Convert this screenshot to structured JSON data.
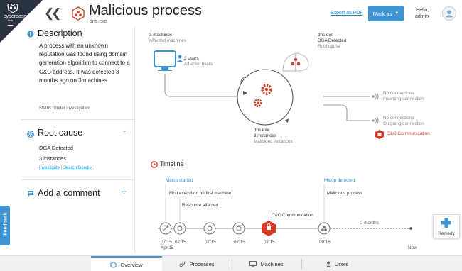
{
  "brand": {
    "name": "cybereason"
  },
  "header": {
    "title": "Malicious process",
    "subtitle": "dns.exe",
    "export_label": "Export as PDF",
    "mark_as_label": "Mark as",
    "greeting": "Hello,",
    "user": "admin"
  },
  "description": {
    "title": "Description",
    "text": "A process with an unknown reputation was found using domain generation algorithm to connect to a C&C address. It was detected 3 months ago on 3 machines",
    "status": "Status: Under investigation"
  },
  "root_cause": {
    "title": "Root cause",
    "line1": "DGA Detected",
    "line2": "3 instances",
    "link1": "Investigate",
    "separator": "|",
    "link2": "Search Google"
  },
  "comment": {
    "title": "Add a comment"
  },
  "feedback": {
    "label": "Feedback"
  },
  "diagram": {
    "machines": {
      "count": "3 machines",
      "label": "Affected machines"
    },
    "users": {
      "count": "3 users",
      "label": "Affected users"
    },
    "root": {
      "name": "dns.exe",
      "detail": "DGA Detected",
      "label": "Root cause"
    },
    "center": {
      "name": "dns.exe",
      "count": "3 instances",
      "label": "Malicious instances"
    },
    "incoming": {
      "title": "No connections",
      "label": "Incoming connection"
    },
    "outgoing": {
      "title": "No connections",
      "label": "Outgoing connection"
    },
    "cc": {
      "label": "C&C Communication"
    }
  },
  "timeline": {
    "title": "Timeline",
    "malop_started": "Malop started",
    "malop_detected": "Malop detected",
    "events": [
      "First execution on first machine",
      "Resource affected",
      "C&C Communication",
      "Malicious process"
    ],
    "times": [
      "07:15",
      "Apr 15",
      "07:15",
      "07:15",
      "07:15",
      "07:15",
      "09:16"
    ],
    "gap_label": "3 months",
    "now_label": "Now"
  },
  "remedy": {
    "label": "Remedy"
  },
  "tabs": [
    "Overview",
    "Processes",
    "Machines",
    "Users"
  ],
  "colors": {
    "accent": "#3f94d3",
    "alert": "#d63a22",
    "dark": "#2a3340"
  }
}
